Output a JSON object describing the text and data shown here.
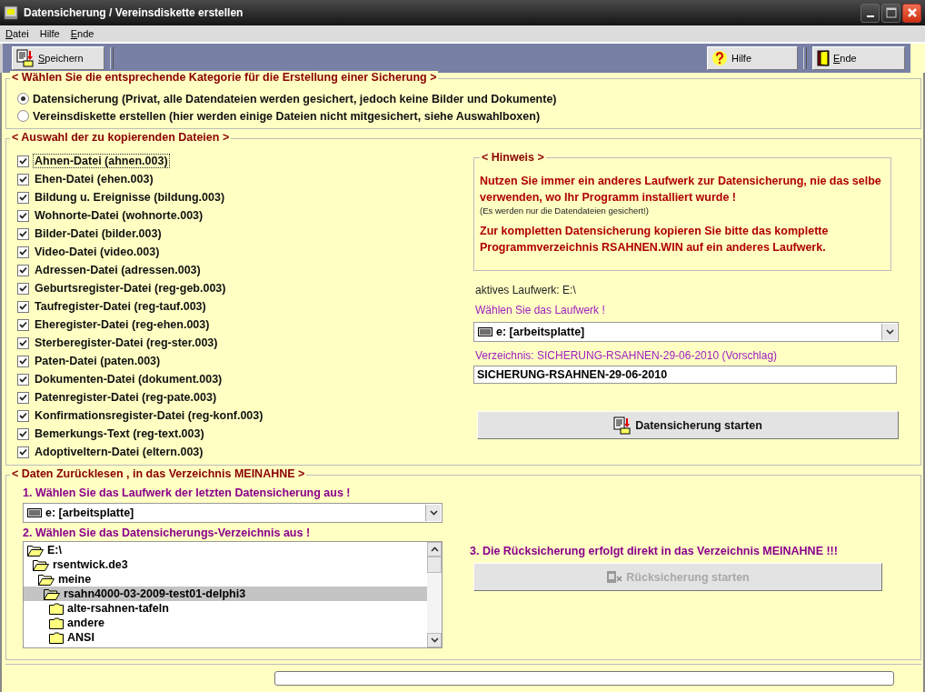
{
  "window": {
    "title": "Datensicherung / Vereinsdiskette erstellen"
  },
  "menu": [
    {
      "label": "Datei"
    },
    {
      "label": "Hilfe"
    },
    {
      "label": "Ende"
    }
  ],
  "toolbar": {
    "left": [
      {
        "label": "Speichern"
      }
    ],
    "right": [
      {
        "label": "Hilfe"
      },
      {
        "label": "Ende"
      }
    ]
  },
  "category_section": {
    "title": "< Wählen Sie die entsprechende Kategorie für die Erstellung einer Sicherung >",
    "options": [
      {
        "label": "Datensicherung (Privat, alle Datendateien werden gesichert, jedoch keine Bilder und Dokumente)",
        "selected": true
      },
      {
        "label": "Vereinsdiskette erstellen (hier werden einige Dateien nicht mitgesichert, siehe Auswahlboxen)",
        "selected": false
      }
    ]
  },
  "files_section": {
    "title": "< Auswahl der zu kopierenden Dateien >",
    "files": [
      {
        "label": "Ahnen-Datei (ahnen.003)",
        "checked": true,
        "focused": true
      },
      {
        "label": "Ehen-Datei (ehen.003)",
        "checked": true,
        "focused": false
      },
      {
        "label": "Bildung u. Ereignisse (bildung.003)",
        "checked": true,
        "focused": false
      },
      {
        "label": "Wohnorte-Datei (wohnorte.003)",
        "checked": true,
        "focused": false
      },
      {
        "label": "Bilder-Datei (bilder.003)",
        "checked": true,
        "focused": false
      },
      {
        "label": "Video-Datei (video.003)",
        "checked": true,
        "focused": false
      },
      {
        "label": "Adressen-Datei (adressen.003)",
        "checked": true,
        "focused": false
      },
      {
        "label": "Geburtsregister-Datei (reg-geb.003)",
        "checked": true,
        "focused": false
      },
      {
        "label": "Taufregister-Datei (reg-tauf.003)",
        "checked": true,
        "focused": false
      },
      {
        "label": "Eheregister-Datei (reg-ehen.003)",
        "checked": true,
        "focused": false
      },
      {
        "label": "Sterberegister-Datei (reg-ster.003)",
        "checked": true,
        "focused": false
      },
      {
        "label": "Paten-Datei (paten.003)",
        "checked": true,
        "focused": false
      },
      {
        "label": "Dokumenten-Datei (dokument.003)",
        "checked": true,
        "focused": false
      },
      {
        "label": "Patenregister-Datei (reg-pate.003)",
        "checked": true,
        "focused": false
      },
      {
        "label": "Konfirmationsregister-Datei (reg-konf.003)",
        "checked": true,
        "focused": false
      },
      {
        "label": "Bemerkungs-Text (reg-text.003)",
        "checked": true,
        "focused": false
      },
      {
        "label": "Adoptiveltern-Datei (eltern.003)",
        "checked": true,
        "focused": false
      }
    ],
    "hint": {
      "title": "< Hinweis >",
      "paragraphs": [
        {
          "kind": "warning",
          "text": "Nutzen Sie immer ein anderes Laufwerk zur Datensicherung, nie das selbe verwenden, wo Ihr Programm installiert wurde !"
        },
        {
          "kind": "note",
          "text": "(Es werden nur die Datendateien gesichert!)"
        },
        {
          "kind": "warning",
          "text": "Zur kompletten Datensicherung kopieren Sie bitte das komplette Programmverzeichnis RSAHNEN.WIN auf ein anderes Laufwerk."
        }
      ]
    },
    "active_drive": "aktives Laufwerk: E:\\",
    "drive_prompt": "Wählen Sie das Laufwerk !",
    "drive_select": {
      "value": "e: [arbeitsplatte]"
    },
    "directory_label": "Verzeichnis: SICHERUNG-RSAHNEN-29-06-2010 (Vorschlag)",
    "directory_field": {
      "value": "SICHERUNG-RSAHNEN-29-06-2010"
    },
    "start_button": {
      "label": "Datensicherung starten",
      "disabled": false
    }
  },
  "restore_section": {
    "title": "< Daten Zurücklesen , in das Verzeichnis MEINAHNE >",
    "step1": "1. Wählen Sie das Laufwerk der letzten Datensicherung aus !",
    "drive_select": {
      "value": "e: [arbeitsplatte]"
    },
    "step2": "2. Wählen Sie das Datensicherungs-Verzeichnis aus !",
    "tree": [
      {
        "label": "E:\\",
        "expanded": true,
        "selected": false,
        "children": [
          {
            "label": "rsentwick.de3",
            "expanded": true,
            "selected": false,
            "children": [
              {
                "label": "meine",
                "expanded": true,
                "selected": false,
                "children": [
                  {
                    "label": "rsahn4000-03-2009-test01-delphi3",
                    "expanded": true,
                    "selected": true,
                    "children": [
                      {
                        "label": "alte-rsahnen-tafeln",
                        "expanded": false,
                        "selected": false
                      },
                      {
                        "label": "andere",
                        "expanded": false,
                        "selected": false
                      },
                      {
                        "label": "ANSI",
                        "expanded": false,
                        "selected": false
                      }
                    ]
                  }
                ]
              }
            ]
          }
        ]
      }
    ],
    "step3": "3. Die Rücksicherung erfolgt direkt in das Verzeichnis MEINAHNE !!!",
    "restore_button": {
      "label": "Rücksicherung starten",
      "disabled": true
    }
  },
  "status_bar": {
    "progress": {
      "level": 0
    }
  }
}
